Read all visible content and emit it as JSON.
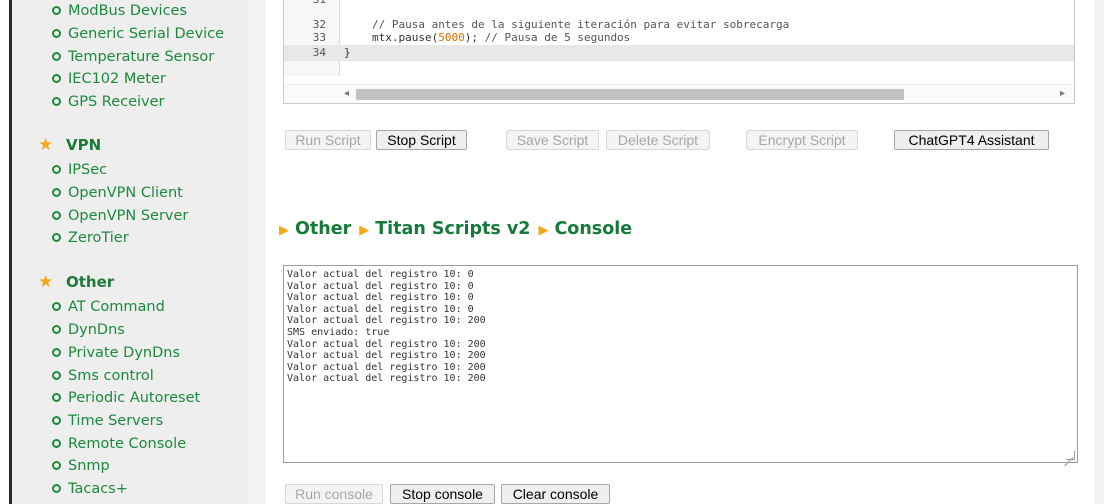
{
  "sidebar": {
    "top_items": [
      {
        "label": "ModBus Devices"
      },
      {
        "label": "Generic Serial Device"
      },
      {
        "label": "Temperature Sensor"
      },
      {
        "label": "IEC102 Meter"
      },
      {
        "label": "GPS Receiver"
      }
    ],
    "vpn": {
      "title": "VPN",
      "items": [
        {
          "label": "IPSec"
        },
        {
          "label": "OpenVPN Client"
        },
        {
          "label": "OpenVPN Server"
        },
        {
          "label": "ZeroTier"
        }
      ]
    },
    "other": {
      "title": "Other",
      "items": [
        {
          "label": "AT Command"
        },
        {
          "label": "DynDns"
        },
        {
          "label": "Private DynDns"
        },
        {
          "label": "Sms control"
        },
        {
          "label": "Periodic Autoreset"
        },
        {
          "label": "Time Servers"
        },
        {
          "label": "Remote Console"
        },
        {
          "label": "Snmp"
        },
        {
          "label": "Tacacs+"
        }
      ]
    }
  },
  "editor": {
    "lines": [
      {
        "number": "32",
        "comment": "// Pausa antes de la siguiente iteración para evitar sobrecarga"
      },
      {
        "number": "33",
        "code_pre": "mtx.pause(",
        "code_num": "5000",
        "code_post": "); ",
        "code_comment": "// Pausa de 5 segundos"
      },
      {
        "number": "34",
        "code": "}"
      }
    ]
  },
  "script_buttons": {
    "run": "Run Script",
    "stop": "Stop Script",
    "save": "Save Script",
    "delete": "Delete Script",
    "encrypt": "Encrypt Script",
    "assistant": "ChatGPT4 Assistant"
  },
  "breadcrumb": [
    "Other",
    "Titan Scripts v2",
    "Console"
  ],
  "console": {
    "lines": [
      "Valor actual del registro 10: 0",
      "Valor actual del registro 10: 0",
      "Valor actual del registro 10: 0",
      "Valor actual del registro 10: 0",
      "Valor actual del registro 10: 200",
      "SMS enviado: true",
      "Valor actual del registro 10: 200",
      "Valor actual del registro 10: 200",
      "Valor actual del registro 10: 200",
      "Valor actual del registro 10: 200"
    ]
  },
  "console_buttons": {
    "run": "Run console",
    "stop": "Stop console",
    "clear": "Clear console"
  },
  "colors": {
    "nav_green": "#1b8a3d",
    "heading_green": "#157a3a",
    "accent_orange": "#f2a91a"
  }
}
